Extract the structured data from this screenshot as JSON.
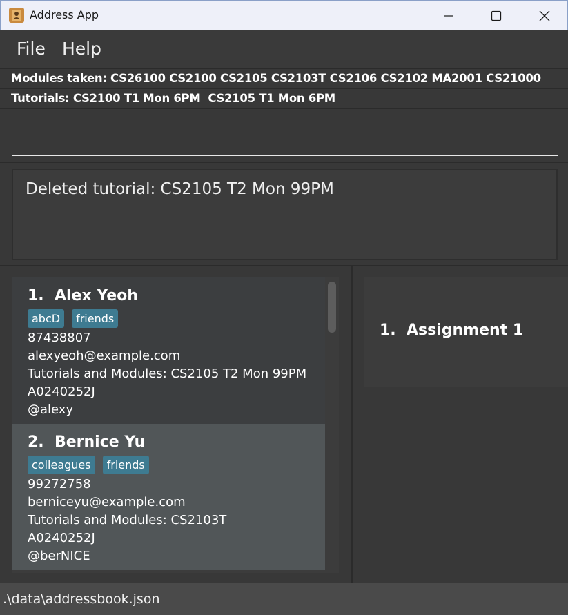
{
  "window": {
    "title": "Address App",
    "icon": "address-book-icon"
  },
  "menu": {
    "file": "File",
    "help": "Help"
  },
  "modules_bar": "Modules taken: CS26100 CS2100 CS2105 CS2103T CS2106 CS2102 MA2001 CS21000",
  "tutorials_bar": "Tutorials: CS2100 T1 Mon 6PM  CS2105 T1 Mon 6PM",
  "command": {
    "value": ""
  },
  "result": {
    "text": "Deleted tutorial: CS2105 T2 Mon 99PM"
  },
  "persons": [
    {
      "index_name": "1.  Alex Yeoh",
      "tags": [
        "abcD",
        "friends"
      ],
      "phone": "87438807",
      "email": "alexyeoh@example.com",
      "tutorials": "Tutorials and Modules: CS2105 T2 Mon 99PM",
      "student_id": "A0240252J",
      "handle": "@alexy"
    },
    {
      "index_name": "2.  Bernice Yu",
      "tags": [
        "colleagues",
        "friends"
      ],
      "phone": "99272758",
      "email": "berniceyu@example.com",
      "tutorials": "Tutorials and Modules: CS2103T",
      "student_id": "A0240252J",
      "handle": "@berNICE"
    }
  ],
  "assignments": [
    {
      "index_name": "1.  Assignment 1"
    }
  ],
  "status_bar": ".\\data\\addressbook.json",
  "colors": {
    "tag": "#3e7b91",
    "selected_card": "#515658",
    "background": "#383838"
  }
}
